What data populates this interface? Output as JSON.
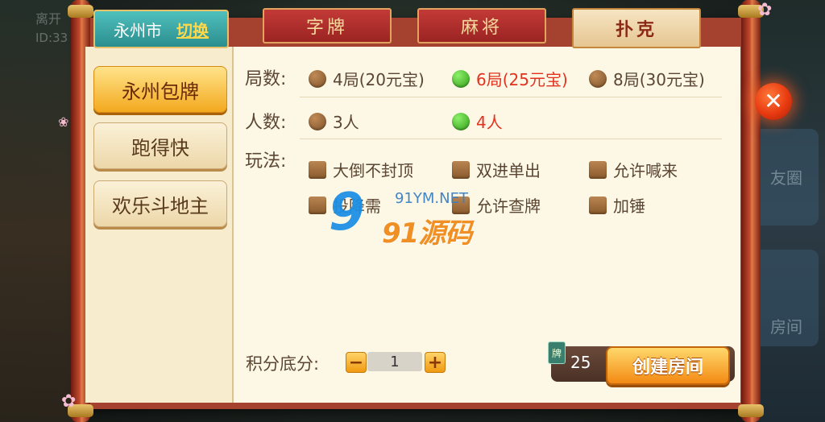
{
  "background": {
    "top_left_text": "离开",
    "top_left_id": "ID:33",
    "right_labels": [
      "友圈",
      "房间"
    ]
  },
  "header": {
    "city": "永州市",
    "switch_label": "切换",
    "tabs": [
      {
        "label": "字牌",
        "active": false
      },
      {
        "label": "麻将",
        "active": false
      },
      {
        "label": "扑克",
        "active": true
      }
    ]
  },
  "sidebar": {
    "items": [
      {
        "label": "永州包牌",
        "active": true
      },
      {
        "label": "跑得快",
        "active": false
      },
      {
        "label": "欢乐斗地主",
        "active": false
      }
    ]
  },
  "options": {
    "rounds_label": "局数:",
    "rounds": [
      {
        "label": "4局(20元宝)",
        "selected": false
      },
      {
        "label": "6局(25元宝)",
        "selected": true
      },
      {
        "label": "8局(30元宝)",
        "selected": false
      }
    ],
    "players_label": "人数:",
    "players": [
      {
        "label": "3人",
        "selected": false
      },
      {
        "label": "4人",
        "selected": true
      }
    ],
    "rules_label": "玩法:",
    "rules": [
      {
        "label": "大倒不封顶",
        "checked": false
      },
      {
        "label": "双进单出",
        "checked": false
      },
      {
        "label": "允许喊来",
        "checked": false
      },
      {
        "label": "投降需",
        "checked": false
      },
      {
        "label": "允许查牌",
        "checked": false
      },
      {
        "label": "加锤",
        "checked": false
      }
    ]
  },
  "score": {
    "label": "积分底分:",
    "minus": "−",
    "plus": "+",
    "value": "1"
  },
  "footer": {
    "cost_icon": "牌",
    "cost": "25",
    "create_label": "创建房间"
  },
  "watermark": {
    "nine": "9",
    "small": "91YM.NET",
    "big": "91源码"
  },
  "colors": {
    "accent": "#f38a13",
    "selected_text": "#e2321f",
    "teal_tab": "#2b8e8e",
    "panel_red": "#a5412f"
  },
  "icons": {
    "close": "close-icon",
    "radio_on": "green-radio-icon",
    "radio_off": "brown-radio-icon"
  }
}
